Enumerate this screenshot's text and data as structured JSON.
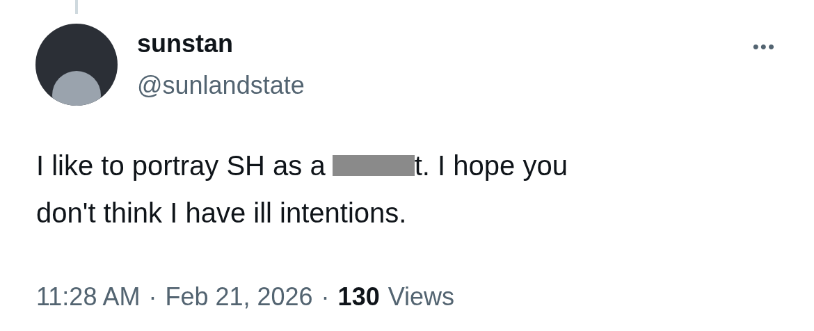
{
  "post": {
    "display_name": "sunstan",
    "handle": "@sunlandstate",
    "more": "•••",
    "body_before": "I like to portray SH as a",
    "body_after": "t. I hope you",
    "body_line_2": "don't think I have ill intentions.",
    "time": "11:28 AM",
    "separator": "·",
    "date": "Feb 21, 2026",
    "views_count": "130",
    "views_label": "Views"
  }
}
